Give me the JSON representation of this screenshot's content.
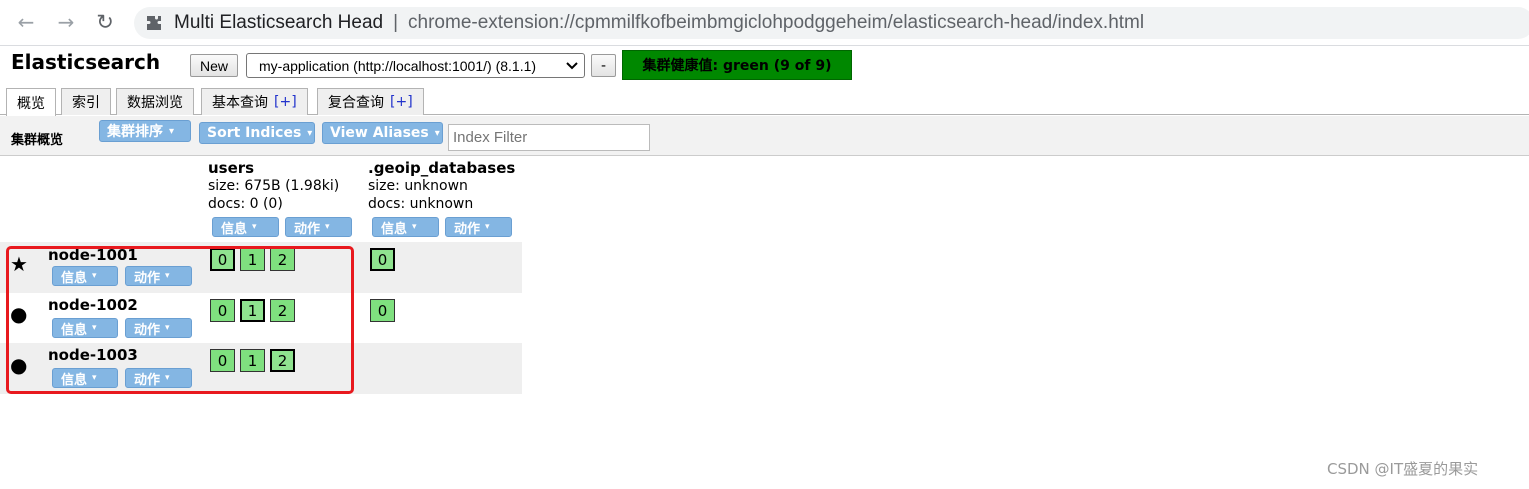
{
  "browser": {
    "back_icon": "←",
    "forward_icon": "→",
    "reload_icon": "↻",
    "tab_title": "Multi Elasticsearch Head",
    "separator": "|",
    "url": "chrome-extension://cpmmilfkofbeimbmgiclohpodggeheim/elasticsearch-head/index.html"
  },
  "header": {
    "brand": "Elasticsearch",
    "new_button": "New",
    "cluster_select": "my-application (http://localhost:1001/) (8.1.1)",
    "minus_button": "-",
    "health": "集群健康值: green (9 of 9)",
    "health_color": "#008800"
  },
  "tabs": [
    {
      "label": "概览",
      "active": true
    },
    {
      "label": "索引"
    },
    {
      "label": "数据浏览"
    },
    {
      "label": "基本查询",
      "plus": "[+]"
    },
    {
      "label": "复合查询",
      "plus": "[+]"
    }
  ],
  "toolbar": {
    "label": "集群概览",
    "cluster_sort": "集群排序",
    "sort_indices": "Sort Indices",
    "view_aliases": "View Aliases",
    "index_filter_placeholder": "Index Filter",
    "dropdown_glyph": "▾"
  },
  "indices": [
    {
      "name": "users",
      "size": "size: 675B (1.98ki)",
      "docs": "docs: 0 (0)",
      "info": "信息",
      "action": "动作"
    },
    {
      "name": ".geoip_databases",
      "size": "size: unknown",
      "docs": "docs: unknown",
      "info": "信息",
      "action": "动作"
    }
  ],
  "nodes": [
    {
      "name": "node-1001",
      "symbol": "★",
      "info": "信息",
      "action": "动作",
      "users_shards": [
        "0",
        "1",
        "2"
      ],
      "geoip_shards": [
        "0"
      ]
    },
    {
      "name": "node-1002",
      "symbol": "●",
      "info": "信息",
      "action": "动作",
      "users_shards": [
        "0",
        "1",
        "2"
      ],
      "geoip_shards": [
        "0"
      ]
    },
    {
      "name": "node-1003",
      "symbol": "●",
      "info": "信息",
      "action": "动作",
      "users_shards": [
        "0",
        "1",
        "2"
      ],
      "geoip_shards": []
    }
  ],
  "watermark": "CSDN @IT盛夏的果实"
}
